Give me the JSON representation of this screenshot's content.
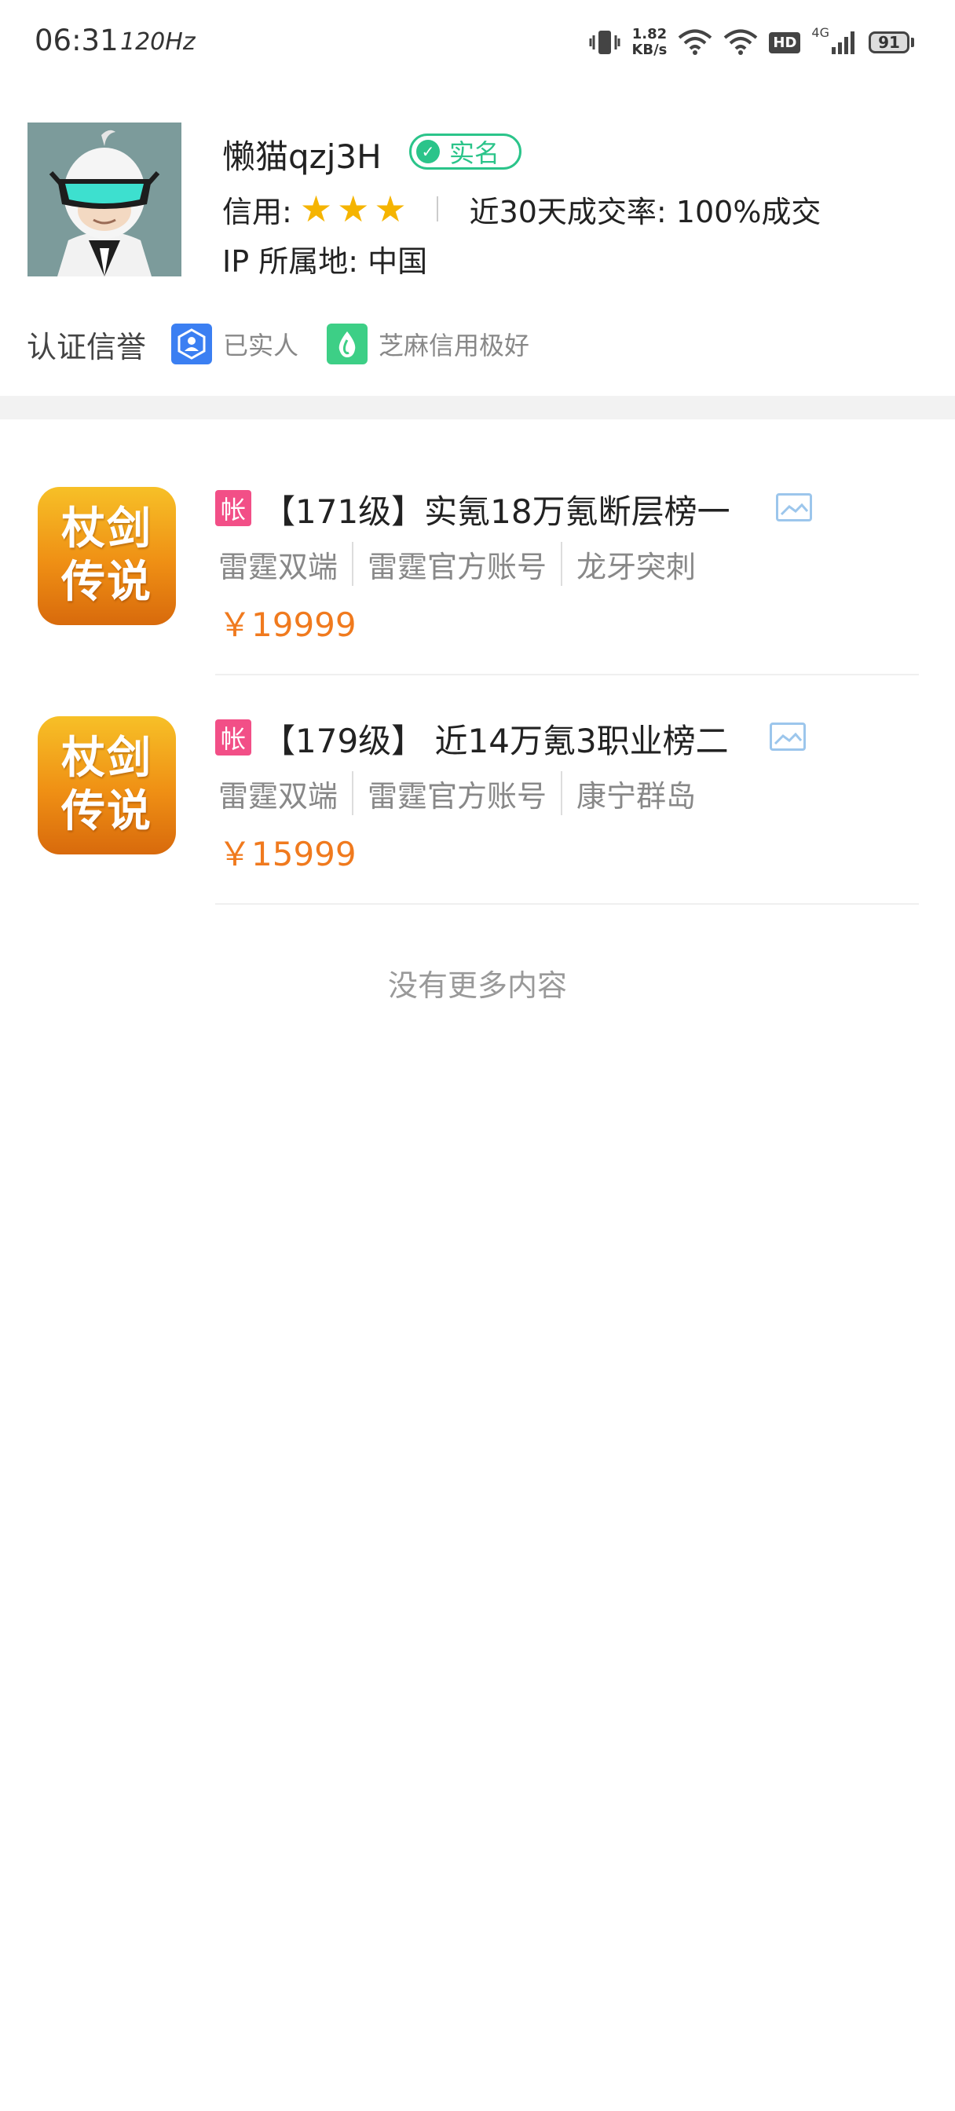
{
  "status_bar": {
    "time": "06:31",
    "refresh_rate": "120Hz",
    "net_speed_value": "1.82",
    "net_speed_unit": "KB/s",
    "hd_label": "HD",
    "network_label": "4G",
    "battery": "91"
  },
  "profile": {
    "username": "懒猫qzj3H",
    "verified_label": "实名",
    "credit_label": "信用:",
    "star_count": 3,
    "deal_rate": "近30天成交率: 100%成交",
    "ip_location": "IP 所属地: 中国"
  },
  "auth": {
    "title": "认证信誉",
    "items": [
      {
        "label": "已实人",
        "icon": "id-verified-icon",
        "color": "#3b7ff2"
      },
      {
        "label": "芝麻信用极好",
        "icon": "sesame-credit-icon",
        "color": "#3dcf86"
      }
    ]
  },
  "listings": [
    {
      "game_icon_line1": "杖剑",
      "game_icon_line2": "传说",
      "tag": "帐",
      "title": "【171级】实氪18万氪断层榜一",
      "tags": [
        "雷霆双端",
        "雷霆官方账号",
        "龙牙突刺"
      ],
      "price": "￥19999"
    },
    {
      "game_icon_line1": "杖剑",
      "game_icon_line2": "传说",
      "tag": "帐",
      "title": "【179级】 近14万氪3职业榜二",
      "tags": [
        "雷霆双端",
        "雷霆官方账号",
        "康宁群岛"
      ],
      "price": "￥15999"
    }
  ],
  "footer": {
    "no_more": "没有更多内容"
  },
  "colors": {
    "accent_green": "#2bc48a",
    "price_orange": "#f07a1e",
    "tag_pink": "#f24f87"
  }
}
